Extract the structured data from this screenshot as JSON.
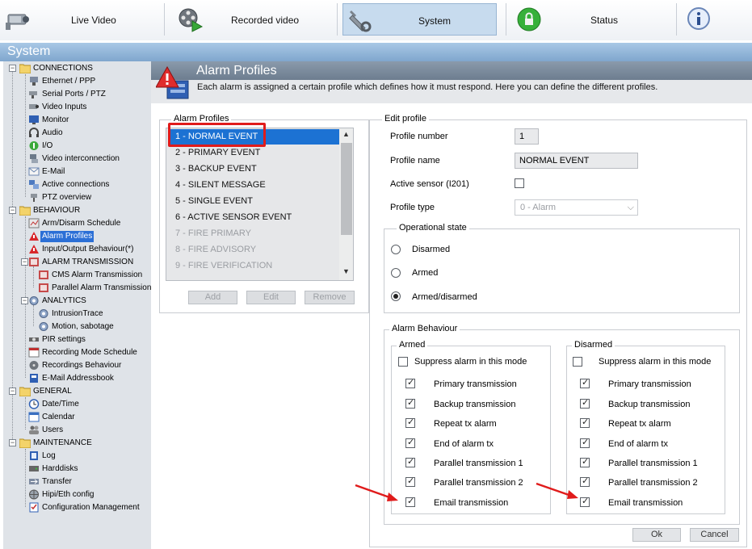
{
  "nav": {
    "tabs": [
      {
        "label": "Live Video",
        "icon": "camera-icon"
      },
      {
        "label": "Recorded video",
        "icon": "film-reel-icon"
      },
      {
        "label": "System",
        "icon": "wrench-icon",
        "active": true
      },
      {
        "label": "Status",
        "icon": "lock-icon"
      },
      {
        "label": "",
        "icon": "info-icon"
      }
    ]
  },
  "title": "System",
  "sidebar": {
    "categories": [
      {
        "label": "CONNECTIONS",
        "items": [
          "Ethernet / PPP",
          "Serial Ports / PTZ",
          "Video Inputs",
          "Monitor",
          "Audio",
          "I/O",
          "Video interconnection",
          "E-Mail",
          "Active connections",
          "PTZ overview"
        ]
      },
      {
        "label": "BEHAVIOUR",
        "items": [
          "Arm/Disarm Schedule",
          "Alarm Profiles",
          "Input/Output Behaviour(*)",
          "ALARM TRANSMISSION",
          "CMS Alarm Transmission",
          "Parallel Alarm Transmission",
          "ANALYTICS",
          "IntrusionTrace",
          "Motion, sabotage",
          "PIR settings",
          "Recording Mode Schedule",
          "Recordings Behaviour",
          "E-Mail Addressbook"
        ]
      },
      {
        "label": "GENERAL",
        "items": [
          "Date/Time",
          "Calendar",
          "Users"
        ]
      },
      {
        "label": "MAINTENANCE",
        "items": [
          "Log",
          "Harddisks",
          "Transfer",
          "Hipi/Eth config",
          "Configuration Management"
        ]
      }
    ],
    "selected": "Alarm Profiles"
  },
  "page": {
    "title": "Alarm Profiles",
    "description": "Each alarm is assigned a certain profile which defines how it must respond. Here you can define the different profiles."
  },
  "profiles": {
    "legend": "Alarm Profiles",
    "items": [
      "1 - NORMAL EVENT",
      "2 - PRIMARY EVENT",
      "3 - BACKUP EVENT",
      "4 - SILENT MESSAGE",
      "5 - SINGLE EVENT",
      "6 - ACTIVE SENSOR EVENT",
      "7 - FIRE PRIMARY",
      "8 - FIRE ADVISORY",
      "9 - FIRE VERIFICATION"
    ],
    "selected_index": 0,
    "buttons": {
      "add": "Add",
      "edit": "Edit",
      "remove": "Remove"
    }
  },
  "edit": {
    "legend": "Edit profile",
    "profile_number_label": "Profile number",
    "profile_number": "1",
    "profile_name_label": "Profile name",
    "profile_name": "NORMAL EVENT",
    "active_sensor_label": "Active sensor (I201)",
    "active_sensor": false,
    "profile_type_label": "Profile type",
    "profile_type": "0 - Alarm",
    "operational_state": {
      "legend": "Operational state",
      "options": [
        "Disarmed",
        "Armed",
        "Armed/disarmed"
      ],
      "selected": "Armed/disarmed"
    },
    "alarm_behaviour": {
      "legend": "Alarm Behaviour",
      "armed": {
        "legend": "Armed",
        "suppress_label": "Suppress alarm in this mode",
        "suppress": false,
        "options": [
          {
            "label": "Primary transmission",
            "checked": true
          },
          {
            "label": "Backup transmission",
            "checked": true
          },
          {
            "label": "Repeat tx alarm",
            "checked": true
          },
          {
            "label": "End of alarm tx",
            "checked": true
          },
          {
            "label": "Parallel transmission 1",
            "checked": true
          },
          {
            "label": "Parallel transmission 2",
            "checked": true
          },
          {
            "label": "Email transmission",
            "checked": true
          }
        ]
      },
      "disarmed": {
        "legend": "Disarmed",
        "suppress_label": "Suppress alarm in this mode",
        "suppress": false,
        "options": [
          {
            "label": "Primary transmission",
            "checked": true
          },
          {
            "label": "Backup transmission",
            "checked": true
          },
          {
            "label": "Repeat tx alarm",
            "checked": true
          },
          {
            "label": "End of alarm tx",
            "checked": true
          },
          {
            "label": "Parallel transmission 1",
            "checked": true
          },
          {
            "label": "Parallel transmission 2",
            "checked": true
          },
          {
            "label": "Email transmission",
            "checked": true
          }
        ]
      }
    },
    "ok_label": "Ok",
    "cancel_label": "Cancel"
  },
  "colors": {
    "annotation": "#e01b1b",
    "selection": "#1c72d3"
  }
}
